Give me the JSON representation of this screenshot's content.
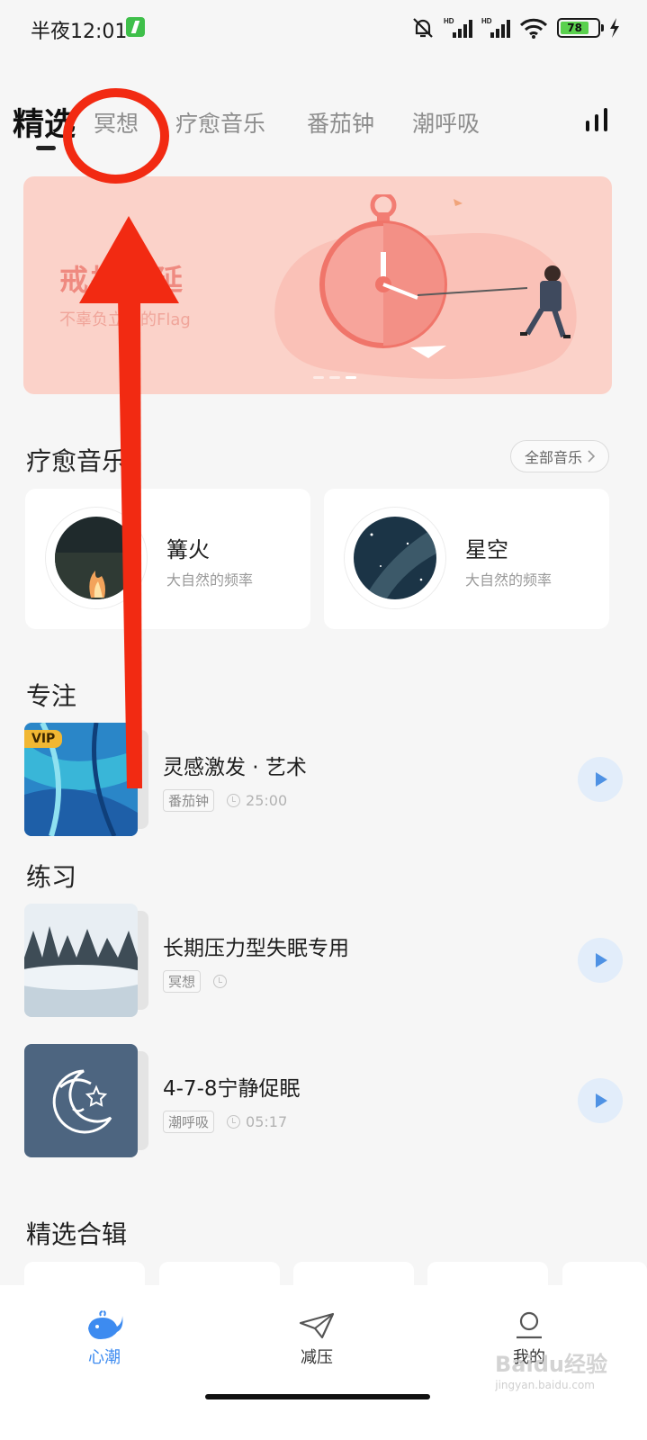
{
  "status_bar": {
    "time": "半夜12:01",
    "battery_level": "78"
  },
  "tabs": [
    {
      "label": "精选",
      "active": true
    },
    {
      "label": "冥想"
    },
    {
      "label": "疗愈音乐"
    },
    {
      "label": "番茄钟"
    },
    {
      "label": "潮呼吸"
    }
  ],
  "banner": {
    "title": "戒掉拖延",
    "subtitle": "不辜负立下的Flag"
  },
  "healing_music": {
    "title": "疗愈音乐",
    "all_label": "全部音乐",
    "cards": [
      {
        "name": "篝火",
        "desc": "大自然的频率"
      },
      {
        "name": "星空",
        "desc": "大自然的频率"
      }
    ]
  },
  "focus": {
    "title": "专注",
    "items": [
      {
        "title": "灵感激发 · 艺术",
        "tag": "番茄钟",
        "duration": "25:00",
        "badge": "VIP"
      }
    ]
  },
  "practice": {
    "title": "练习",
    "items": [
      {
        "title": "长期压力型失眠专用",
        "tag": "冥想",
        "duration": ""
      },
      {
        "title": "4-7-8宁静促眠",
        "tag": "潮呼吸",
        "duration": "05:17"
      }
    ]
  },
  "collections": {
    "title": "精选合辑"
  },
  "bottom_nav": [
    {
      "label": "心潮",
      "active": true
    },
    {
      "label": "减压"
    },
    {
      "label": "我的"
    }
  ],
  "watermark": {
    "text": "Baidu经验",
    "sub": "jingyan.baidu.com"
  },
  "colors": {
    "accent": "#3d8bf0",
    "annotation_red": "#f22a12",
    "banner_bg": "#fbd2c9"
  }
}
